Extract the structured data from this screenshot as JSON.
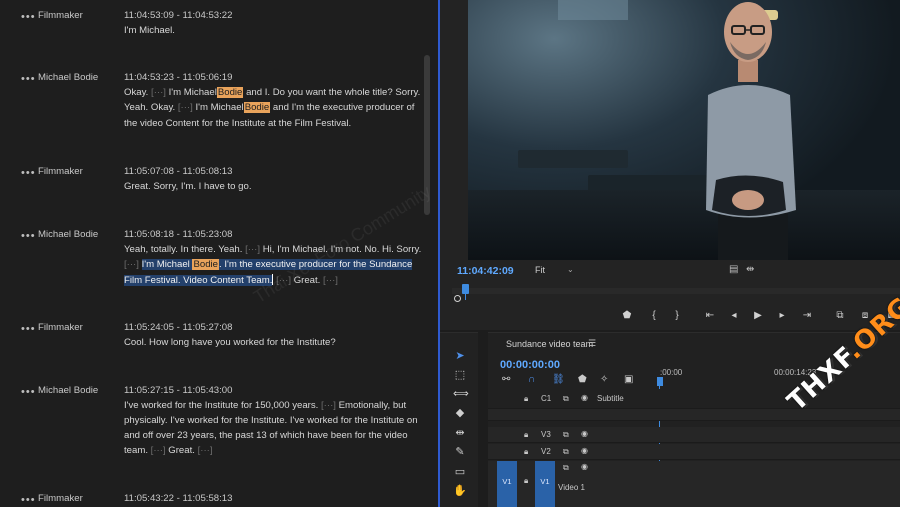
{
  "transcript": {
    "entries": [
      {
        "speaker": "Filmmaker",
        "timecode": "11:04:53:09 - 11:04:53:22",
        "lines": [
          "I'm Michael."
        ]
      },
      {
        "speaker": "Michael Bodie",
        "timecode": "11:04:53:23 - 11:05:06:19",
        "lines": [
          "Okay.",
          "[···]",
          "I'm Michael",
          "Bodie",
          "and I. Do you want the whole title? Sorry.",
          "Yeah. Okay.",
          "[···]",
          "I'm Michael",
          "Bodie",
          "and I'm the executive producer of",
          "the video Content for the Institute at the Film Festival."
        ]
      },
      {
        "speaker": "Filmmaker",
        "timecode": "11:05:07:08 - 11:05:08:13",
        "lines": [
          "Great. Sorry, I'm. I have to go."
        ]
      },
      {
        "speaker": "Michael Bodie",
        "timecode": "11:05:08:18 - 11:05:23:08",
        "lines": [
          "Yeah, totally. In there. Yeah.",
          "[···]",
          "Hi, I'm Michael. I'm not. No. Hi. Sorry.",
          "[···]",
          "I'm Michael",
          "Bodie",
          ". I'm the executive producer for the Sundance",
          "Film Festival. Video Content Team.",
          "[···]",
          "Great.",
          "[···]"
        ]
      },
      {
        "speaker": "Filmmaker",
        "timecode": "11:05:24:05 - 11:05:27:08",
        "lines": [
          "Cool. How long have you worked for the Institute?"
        ]
      },
      {
        "speaker": "Michael Bodie",
        "timecode": "11:05:27:15 - 11:05:43:00",
        "lines": [
          "I've worked for the Institute for 150,000 years.",
          "[···]",
          "Emotionally, but",
          "physically. I've worked for the Institute. I've worked for the Institute on",
          "and off over 23 years, the past 13 of which have been for the video",
          "team.",
          "[···]",
          "Great.",
          "[···]"
        ]
      },
      {
        "speaker": "Filmmaker",
        "timecode": "11:05:43:22 - 11:05:58:13",
        "lines": []
      }
    ],
    "more_icon": "ellipsis-icon"
  },
  "monitor": {
    "timecode": "11:04:42:09",
    "fit_label": "Fit"
  },
  "timeline": {
    "sequence_name": "Sundance video team",
    "timecode": "00:00:00:00",
    "ruler": [
      ":00:00",
      "00:00:14:23"
    ],
    "tracks": [
      {
        "id": "C1",
        "label": "Subtitle"
      },
      {
        "id": "V3",
        "label": ""
      },
      {
        "id": "V2",
        "label": ""
      },
      {
        "id": "V1",
        "label": "Video 1"
      }
    ],
    "source_patch": "V1"
  },
  "watermark": {
    "text": "Thai XenForo Community",
    "brand_main": "THXF",
    "brand_suffix": ".ORG"
  }
}
